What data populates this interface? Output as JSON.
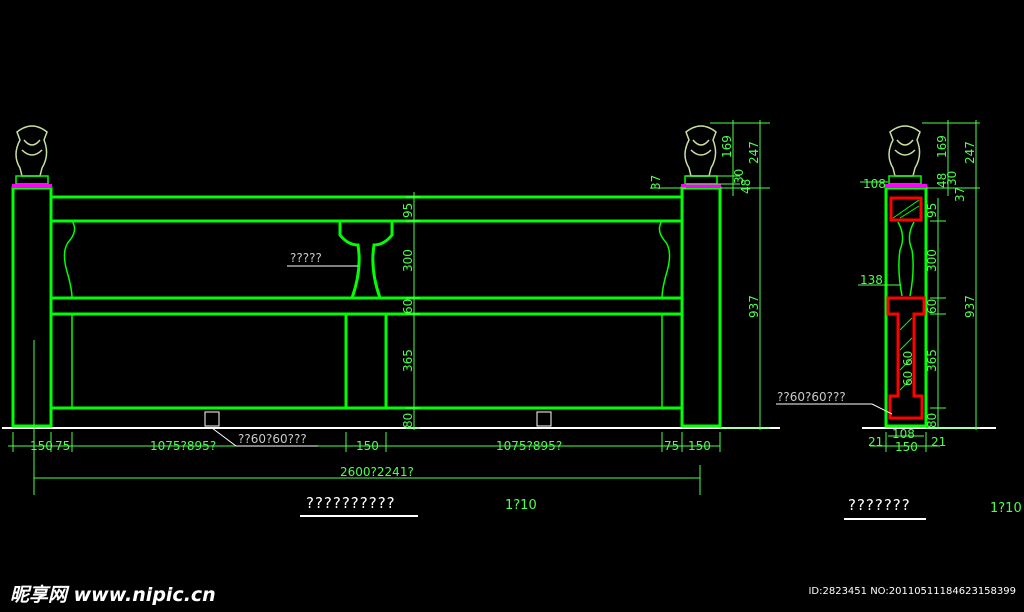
{
  "elevation": {
    "dims": {
      "d150_left": "150",
      "d75_left": "75",
      "span_left": "1075?895?",
      "d150_mid": "150",
      "span_right": "1075?895?",
      "d75_right": "75",
      "d150_right": "150",
      "total": "2600?2241?",
      "v95": "95",
      "v300": "300",
      "v60": "60",
      "v365": "365",
      "v80": "80",
      "v937": "937",
      "v169": "169",
      "v247": "247",
      "v30": "30",
      "v48": "48",
      "v37": "37"
    },
    "labels": {
      "vase_note": "?????",
      "post_note": "??60?60???"
    },
    "title": "??????????",
    "scale": "1?10"
  },
  "section": {
    "dims": {
      "d108_top": "108",
      "d138": "138",
      "v95": "95",
      "v300": "300",
      "v60": "60",
      "v365": "365",
      "v80": "80",
      "v937": "937",
      "v169": "169",
      "v247": "247",
      "v48": "48",
      "v30": "30",
      "v37": "37",
      "d108_bot": "108",
      "d21_left": "21",
      "d150": "150",
      "d21_right": "21",
      "v60_inner": "60",
      "v60_inner2": "60"
    },
    "labels": {
      "post_note": "??60?60???"
    },
    "title": "???????",
    "scale": "1?10"
  },
  "watermark": "昵享网 www.nipic.cn",
  "image_id": "ID:2823451 NO:20110511184623158399",
  "colors": {
    "background": "#000000",
    "rail": "#00ff00",
    "dimension": "#c8c8c8",
    "accent_red": "#ff0000",
    "accent_magenta": "#ff00ff"
  }
}
